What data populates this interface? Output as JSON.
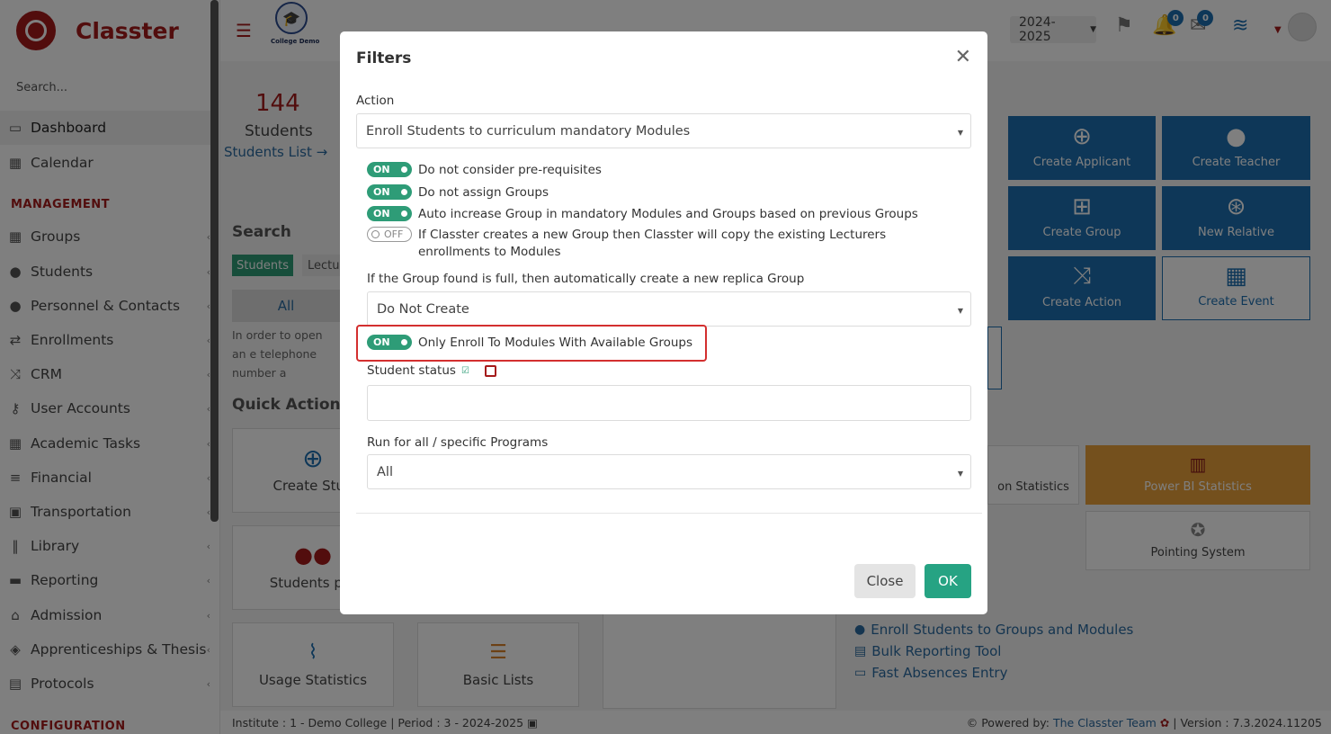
{
  "app": {
    "name": "Classter",
    "college_label": "College Demo"
  },
  "sidebar": {
    "search_placeholder": "Search...",
    "items_top": [
      {
        "label": "Dashboard",
        "icon": "laptop-icon"
      },
      {
        "label": "Calendar",
        "icon": "calendar-icon"
      }
    ],
    "management_heading": "MANAGEMENT",
    "items": [
      {
        "label": "Groups",
        "icon": "groups-icon"
      },
      {
        "label": "Students",
        "icon": "students-icon"
      },
      {
        "label": "Personnel & Contacts",
        "icon": "person-icon"
      },
      {
        "label": "Enrollments",
        "icon": "arrows-icon"
      },
      {
        "label": "CRM",
        "icon": "shuffle-icon"
      },
      {
        "label": "User Accounts",
        "icon": "key-icon"
      },
      {
        "label": "Academic Tasks",
        "icon": "grid-icon"
      },
      {
        "label": "Financial",
        "icon": "coins-icon"
      },
      {
        "label": "Transportation",
        "icon": "bus-icon"
      },
      {
        "label": "Library",
        "icon": "books-icon"
      },
      {
        "label": "Reporting",
        "icon": "printer-icon"
      },
      {
        "label": "Admission",
        "icon": "building-icon"
      },
      {
        "label": "Apprenticeships & Thesis",
        "icon": "cube-icon"
      },
      {
        "label": "Protocols",
        "icon": "protocol-icon"
      }
    ],
    "configuration_heading": "CONFIGURATION"
  },
  "topbar": {
    "year": "2024-2025",
    "notifications_count": "0",
    "messages_count": "0"
  },
  "dashboard": {
    "students_count": "144",
    "students_label": "Students",
    "students_link": "Students List",
    "search_heading": "Search",
    "tab_students": "Students",
    "tab_lecturers": "Lectu",
    "all_label": "All",
    "help_text": "In order to open an e telephone number a",
    "quick_actions_heading": "Quick Actions",
    "qa_cards": [
      "Create Stud",
      "Students per",
      "Usage Statistics",
      "Basic Lists"
    ],
    "tiles": [
      "Create Applicant",
      "Create Teacher",
      "Create Group",
      "New Relative",
      "Create Action",
      "Create Event"
    ],
    "stats_partial": "on Statistics",
    "powerbi": "Power BI Statistics",
    "pointing": "Pointing System",
    "links": [
      "Enroll Students to Groups and Modules",
      "Bulk Reporting Tool",
      "Fast Absences Entry"
    ]
  },
  "footer": {
    "institute": "Institute : 1 - Demo College | Period : 3 - 2024-2025",
    "powered_by": "Powered by:",
    "team": "The Classter Team",
    "version": "| Version : 7.3.2024.11205"
  },
  "modal": {
    "title": "Filters",
    "action_label": "Action",
    "action_value": "Enroll Students to curriculum mandatory Modules",
    "toggles": [
      {
        "state": "ON",
        "text": "Do not consider pre-requisites"
      },
      {
        "state": "ON",
        "text": "Do not assign Groups"
      },
      {
        "state": "ON",
        "text": "Auto increase Group in mandatory Modules and Groups based on previous Groups"
      },
      {
        "state": "OFF",
        "text": "If Classter creates a new Group then Classter will copy the existing Lecturers enrollments to Modules"
      }
    ],
    "replica_label": "If the Group found is full, then automatically create a new replica Group",
    "replica_value": "Do Not Create",
    "available_toggle": {
      "state": "ON",
      "text": "Only Enroll To Modules With Available Groups"
    },
    "student_status_label": "Student status",
    "programs_label": "Run for all / specific Programs",
    "programs_value": "All",
    "close_button": "Close",
    "ok_button": "OK"
  }
}
